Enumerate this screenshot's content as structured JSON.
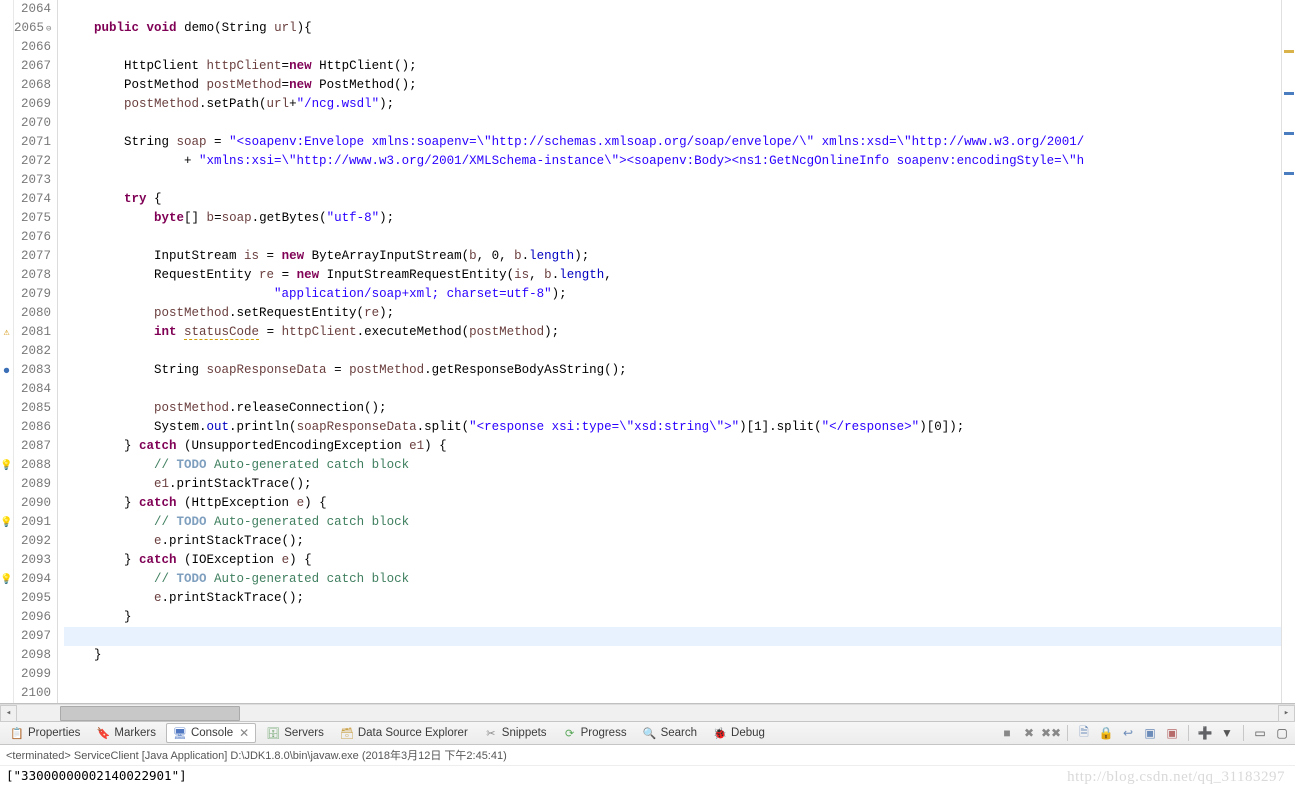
{
  "editor": {
    "first_line": 2064,
    "highlighted_line": 2097,
    "markers": {
      "2081": "warn",
      "2083": "breakpoint",
      "2088": "quickfix",
      "2091": "quickfix",
      "2094": "quickfix"
    },
    "lines": [
      {
        "n": 2064,
        "tokens": [
          {
            "t": "",
            "c": ""
          }
        ]
      },
      {
        "n": 2065,
        "method": true,
        "tokens": [
          {
            "t": "    ",
            "c": ""
          },
          {
            "t": "public",
            "c": "kw"
          },
          {
            "t": " ",
            "c": ""
          },
          {
            "t": "void",
            "c": "kw"
          },
          {
            "t": " demo(String ",
            "c": ""
          },
          {
            "t": "url",
            "c": "var"
          },
          {
            "t": "){",
            "c": ""
          }
        ]
      },
      {
        "n": 2066,
        "tokens": []
      },
      {
        "n": 2067,
        "tokens": [
          {
            "t": "        HttpClient ",
            "c": ""
          },
          {
            "t": "httpClient",
            "c": "var"
          },
          {
            "t": "=",
            "c": ""
          },
          {
            "t": "new",
            "c": "kw"
          },
          {
            "t": " HttpClient();",
            "c": ""
          }
        ]
      },
      {
        "n": 2068,
        "tokens": [
          {
            "t": "        PostMethod ",
            "c": ""
          },
          {
            "t": "postMethod",
            "c": "var"
          },
          {
            "t": "=",
            "c": ""
          },
          {
            "t": "new",
            "c": "kw"
          },
          {
            "t": " PostMethod();",
            "c": ""
          }
        ]
      },
      {
        "n": 2069,
        "tokens": [
          {
            "t": "        ",
            "c": ""
          },
          {
            "t": "postMethod",
            "c": "var"
          },
          {
            "t": ".setPath(",
            "c": ""
          },
          {
            "t": "url",
            "c": "var"
          },
          {
            "t": "+",
            "c": ""
          },
          {
            "t": "\"/ncg.wsdl\"",
            "c": "str"
          },
          {
            "t": ");",
            "c": ""
          }
        ]
      },
      {
        "n": 2070,
        "tokens": []
      },
      {
        "n": 2071,
        "tokens": [
          {
            "t": "        String ",
            "c": ""
          },
          {
            "t": "soap",
            "c": "var"
          },
          {
            "t": " = ",
            "c": ""
          },
          {
            "t": "\"<soapenv:Envelope xmlns:soapenv=\\\"http://schemas.xmlsoap.org/soap/envelope/\\\" xmlns:xsd=\\\"http://www.w3.org/2001/",
            "c": "str"
          }
        ]
      },
      {
        "n": 2072,
        "tokens": [
          {
            "t": "                + ",
            "c": ""
          },
          {
            "t": "\"xmlns:xsi=\\\"http://www.w3.org/2001/XMLSchema-instance\\\"><soapenv:Body><ns1:GetNcgOnlineInfo soapenv:encodingStyle=\\\"h",
            "c": "str"
          }
        ]
      },
      {
        "n": 2073,
        "tokens": []
      },
      {
        "n": 2074,
        "tokens": [
          {
            "t": "        ",
            "c": ""
          },
          {
            "t": "try",
            "c": "kw"
          },
          {
            "t": " {",
            "c": ""
          }
        ]
      },
      {
        "n": 2075,
        "tokens": [
          {
            "t": "            ",
            "c": ""
          },
          {
            "t": "byte",
            "c": "kw"
          },
          {
            "t": "[] ",
            "c": ""
          },
          {
            "t": "b",
            "c": "var"
          },
          {
            "t": "=",
            "c": ""
          },
          {
            "t": "soap",
            "c": "var"
          },
          {
            "t": ".getBytes(",
            "c": ""
          },
          {
            "t": "\"utf-8\"",
            "c": "str"
          },
          {
            "t": ");",
            "c": ""
          }
        ]
      },
      {
        "n": 2076,
        "tokens": []
      },
      {
        "n": 2077,
        "tokens": [
          {
            "t": "            InputStream ",
            "c": ""
          },
          {
            "t": "is",
            "c": "var"
          },
          {
            "t": " = ",
            "c": ""
          },
          {
            "t": "new",
            "c": "kw"
          },
          {
            "t": " ByteArrayInputStream(",
            "c": ""
          },
          {
            "t": "b",
            "c": "var"
          },
          {
            "t": ", 0, ",
            "c": ""
          },
          {
            "t": "b",
            "c": "var"
          },
          {
            "t": ".",
            "c": ""
          },
          {
            "t": "length",
            "c": "fld"
          },
          {
            "t": ");",
            "c": ""
          }
        ]
      },
      {
        "n": 2078,
        "tokens": [
          {
            "t": "            RequestEntity ",
            "c": ""
          },
          {
            "t": "re",
            "c": "var"
          },
          {
            "t": " = ",
            "c": ""
          },
          {
            "t": "new",
            "c": "kw"
          },
          {
            "t": " InputStreamRequestEntity(",
            "c": ""
          },
          {
            "t": "is",
            "c": "var"
          },
          {
            "t": ", ",
            "c": ""
          },
          {
            "t": "b",
            "c": "var"
          },
          {
            "t": ".",
            "c": ""
          },
          {
            "t": "length",
            "c": "fld"
          },
          {
            "t": ",",
            "c": ""
          }
        ]
      },
      {
        "n": 2079,
        "tokens": [
          {
            "t": "                            ",
            "c": ""
          },
          {
            "t": "\"application/soap+xml; charset=utf-8\"",
            "c": "str"
          },
          {
            "t": ");",
            "c": ""
          }
        ]
      },
      {
        "n": 2080,
        "tokens": [
          {
            "t": "            ",
            "c": ""
          },
          {
            "t": "postMethod",
            "c": "var"
          },
          {
            "t": ".setRequestEntity(",
            "c": ""
          },
          {
            "t": "re",
            "c": "var"
          },
          {
            "t": ");",
            "c": ""
          }
        ]
      },
      {
        "n": 2081,
        "tokens": [
          {
            "t": "            ",
            "c": ""
          },
          {
            "t": "int",
            "c": "kw"
          },
          {
            "t": " ",
            "c": ""
          },
          {
            "t": "statusCode",
            "c": "var warnuline"
          },
          {
            "t": " = ",
            "c": ""
          },
          {
            "t": "httpClient",
            "c": "var"
          },
          {
            "t": ".executeMethod(",
            "c": ""
          },
          {
            "t": "postMethod",
            "c": "var"
          },
          {
            "t": ");",
            "c": ""
          }
        ]
      },
      {
        "n": 2082,
        "tokens": []
      },
      {
        "n": 2083,
        "tokens": [
          {
            "t": "            String ",
            "c": ""
          },
          {
            "t": "soapResponseData",
            "c": "var"
          },
          {
            "t": " = ",
            "c": ""
          },
          {
            "t": "postMethod",
            "c": "var"
          },
          {
            "t": ".getResponseBodyAsString();",
            "c": ""
          }
        ]
      },
      {
        "n": 2084,
        "tokens": []
      },
      {
        "n": 2085,
        "tokens": [
          {
            "t": "            ",
            "c": ""
          },
          {
            "t": "postMethod",
            "c": "var"
          },
          {
            "t": ".releaseConnection();",
            "c": ""
          }
        ]
      },
      {
        "n": 2086,
        "tokens": [
          {
            "t": "            System.",
            "c": ""
          },
          {
            "t": "out",
            "c": "fld"
          },
          {
            "t": ".println(",
            "c": ""
          },
          {
            "t": "soapResponseData",
            "c": "var"
          },
          {
            "t": ".split(",
            "c": ""
          },
          {
            "t": "\"<response xsi:type=\\\"xsd:string\\\">\"",
            "c": "str"
          },
          {
            "t": ")[1].split(",
            "c": ""
          },
          {
            "t": "\"</response>\"",
            "c": "str"
          },
          {
            "t": ")[0]);",
            "c": ""
          }
        ]
      },
      {
        "n": 2087,
        "tokens": [
          {
            "t": "        } ",
            "c": ""
          },
          {
            "t": "catch",
            "c": "kw"
          },
          {
            "t": " (UnsupportedEncodingException ",
            "c": ""
          },
          {
            "t": "e1",
            "c": "var"
          },
          {
            "t": ") {",
            "c": ""
          }
        ]
      },
      {
        "n": 2088,
        "tokens": [
          {
            "t": "            ",
            "c": ""
          },
          {
            "t": "// ",
            "c": "cm"
          },
          {
            "t": "TODO",
            "c": "tag"
          },
          {
            "t": " Auto-generated catch block",
            "c": "cm"
          }
        ]
      },
      {
        "n": 2089,
        "tokens": [
          {
            "t": "            ",
            "c": ""
          },
          {
            "t": "e1",
            "c": "var"
          },
          {
            "t": ".printStackTrace();",
            "c": ""
          }
        ]
      },
      {
        "n": 2090,
        "tokens": [
          {
            "t": "        } ",
            "c": ""
          },
          {
            "t": "catch",
            "c": "kw"
          },
          {
            "t": " (HttpException ",
            "c": ""
          },
          {
            "t": "e",
            "c": "var"
          },
          {
            "t": ") {",
            "c": ""
          }
        ]
      },
      {
        "n": 2091,
        "tokens": [
          {
            "t": "            ",
            "c": ""
          },
          {
            "t": "// ",
            "c": "cm"
          },
          {
            "t": "TODO",
            "c": "tag"
          },
          {
            "t": " Auto-generated catch block",
            "c": "cm"
          }
        ]
      },
      {
        "n": 2092,
        "tokens": [
          {
            "t": "            ",
            "c": ""
          },
          {
            "t": "e",
            "c": "var"
          },
          {
            "t": ".printStackTrace();",
            "c": ""
          }
        ]
      },
      {
        "n": 2093,
        "tokens": [
          {
            "t": "        } ",
            "c": ""
          },
          {
            "t": "catch",
            "c": "kw"
          },
          {
            "t": " (IOException ",
            "c": ""
          },
          {
            "t": "e",
            "c": "var"
          },
          {
            "t": ") {",
            "c": ""
          }
        ]
      },
      {
        "n": 2094,
        "tokens": [
          {
            "t": "            ",
            "c": ""
          },
          {
            "t": "// ",
            "c": "cm"
          },
          {
            "t": "TODO",
            "c": "tag"
          },
          {
            "t": " Auto-generated catch block",
            "c": "cm"
          }
        ]
      },
      {
        "n": 2095,
        "tokens": [
          {
            "t": "            ",
            "c": ""
          },
          {
            "t": "e",
            "c": "var"
          },
          {
            "t": ".printStackTrace();",
            "c": ""
          }
        ]
      },
      {
        "n": 2096,
        "tokens": [
          {
            "t": "        }",
            "c": ""
          }
        ]
      },
      {
        "n": 2097,
        "tokens": [
          {
            "t": "        ",
            "c": ""
          }
        ]
      },
      {
        "n": 2098,
        "tokens": [
          {
            "t": "    }",
            "c": ""
          }
        ]
      },
      {
        "n": 2099,
        "tokens": []
      },
      {
        "n": 2100,
        "tokens": []
      }
    ]
  },
  "views": {
    "tabs": [
      {
        "icon": "📋",
        "color": "#7a94c8",
        "label": "Properties"
      },
      {
        "icon": "🔖",
        "color": "#c89a54",
        "label": "Markers"
      },
      {
        "icon": "🖥",
        "color": "#5078c2",
        "label": "Console",
        "active": true,
        "closable": true
      },
      {
        "icon": "🗄",
        "color": "#6aa36a",
        "label": "Servers"
      },
      {
        "icon": "🗃",
        "color": "#caa24a",
        "label": "Data Source Explorer"
      },
      {
        "icon": "✂",
        "color": "#888",
        "label": "Snippets"
      },
      {
        "icon": "⟳",
        "color": "#5aa85a",
        "label": "Progress"
      },
      {
        "icon": "🔍",
        "color": "#c0a030",
        "label": "Search"
      },
      {
        "icon": "🐞",
        "color": "#7aa760",
        "label": "Debug"
      }
    ],
    "toolbar": [
      {
        "name": "terminate-icon",
        "glyph": "■",
        "color": "#888"
      },
      {
        "name": "remove-launch-icon",
        "glyph": "✖",
        "color": "#888"
      },
      {
        "name": "remove-all-icon",
        "glyph": "✖✖",
        "color": "#888"
      },
      {
        "sep": true
      },
      {
        "name": "clear-console-icon",
        "glyph": "🗎",
        "color": "#6b8bb8"
      },
      {
        "name": "scroll-lock-icon",
        "glyph": "🔒",
        "color": "#8a7a4a"
      },
      {
        "name": "word-wrap-icon",
        "glyph": "↩",
        "color": "#6b8bb8"
      },
      {
        "name": "show-console-icon",
        "glyph": "▣",
        "color": "#6b8bb8"
      },
      {
        "name": "show-console-on-err-icon",
        "glyph": "▣",
        "color": "#b86b6b"
      },
      {
        "sep": true
      },
      {
        "name": "open-console-icon",
        "glyph": "➕",
        "color": "#5aa85a"
      },
      {
        "name": "display-selected-console-icon",
        "glyph": "▼",
        "color": "#555"
      },
      {
        "sep": true
      },
      {
        "name": "minimize-icon",
        "glyph": "▭",
        "color": "#555"
      },
      {
        "name": "maximize-icon",
        "glyph": "▢",
        "color": "#555"
      }
    ]
  },
  "console": {
    "header": "<terminated> ServiceClient [Java Application] D:\\JDK1.8.0\\bin\\javaw.exe (2018年3月12日 下午2:45:41)",
    "output": "[\"33000000002140022901\"]"
  },
  "watermark": "http://blog.csdn.net/qq_31183297"
}
